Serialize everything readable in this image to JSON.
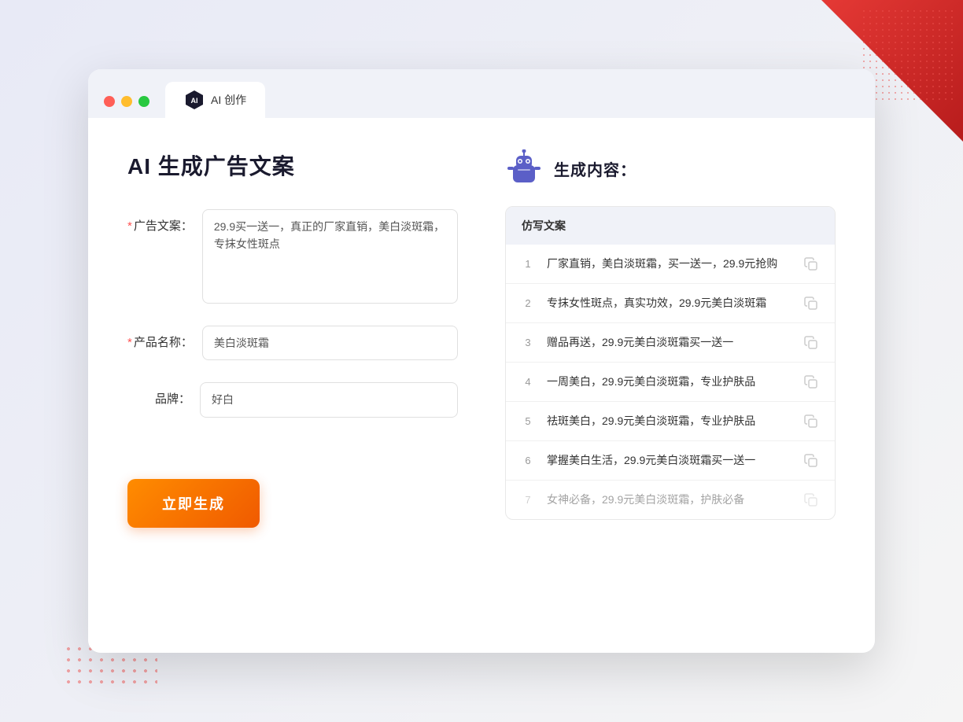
{
  "window": {
    "tab_label": "AI 创作"
  },
  "page": {
    "title": "AI 生成广告文案",
    "right_title": "生成内容："
  },
  "form": {
    "ad_copy_label": "广告文案：",
    "ad_copy_required": true,
    "ad_copy_value": "29.9买一送一，真正的厂家直销，美白淡斑霜，专抹女性斑点",
    "product_name_label": "产品名称：",
    "product_name_required": true,
    "product_name_value": "美白淡斑霜",
    "brand_label": "品牌：",
    "brand_required": false,
    "brand_value": "好白",
    "generate_button": "立即生成"
  },
  "results": {
    "column_header": "仿写文案",
    "items": [
      {
        "num": "1",
        "text": "厂家直销，美白淡斑霜，买一送一，29.9元抢购",
        "faded": false
      },
      {
        "num": "2",
        "text": "专抹女性斑点，真实功效，29.9元美白淡斑霜",
        "faded": false
      },
      {
        "num": "3",
        "text": "赠品再送，29.9元美白淡斑霜买一送一",
        "faded": false
      },
      {
        "num": "4",
        "text": "一周美白，29.9元美白淡斑霜，专业护肤品",
        "faded": false
      },
      {
        "num": "5",
        "text": "祛斑美白，29.9元美白淡斑霜，专业护肤品",
        "faded": false
      },
      {
        "num": "6",
        "text": "掌握美白生活，29.9元美白淡斑霜买一送一",
        "faded": false
      },
      {
        "num": "7",
        "text": "女神必备，29.9元美白淡斑霜，护肤必备",
        "faded": true
      }
    ]
  },
  "colors": {
    "accent_orange": "#f05a00",
    "accent_blue": "#7c8cf8",
    "bg_light": "#f0f2f8"
  }
}
